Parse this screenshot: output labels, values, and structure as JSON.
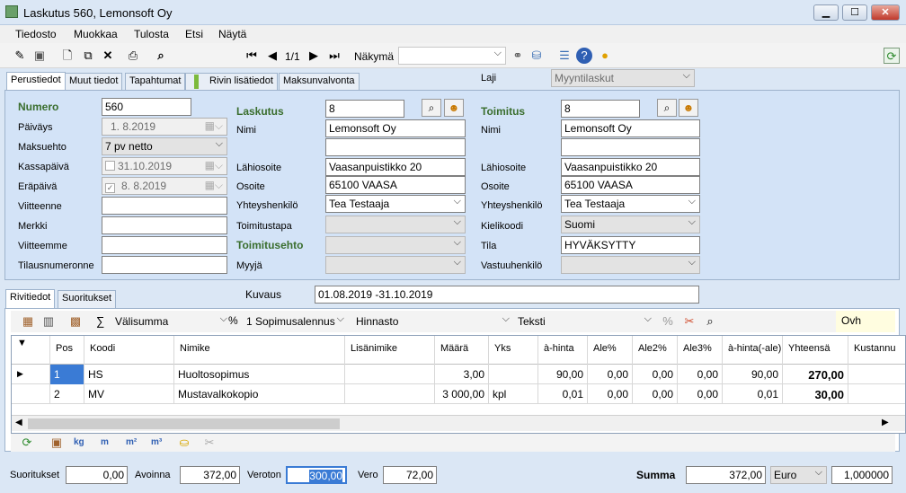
{
  "window": {
    "title": "Laskutus 560, Lemonsoft Oy",
    "min": "▁",
    "max": "☐",
    "close": "✕"
  },
  "menu": [
    "Tiedosto",
    "Muokkaa",
    "Tulosta",
    "Etsi",
    "Näytä"
  ],
  "toolbar": {
    "page": "1/1",
    "view_label": "Näkymä"
  },
  "tabs": [
    "Perustiedot",
    "Muut tiedot",
    "Tapahtumat",
    "Rivin lisätiedot",
    "Maksunvalvonta"
  ],
  "laji": {
    "label": "Laji",
    "value": "Myyntilaskut"
  },
  "left": {
    "numero_label": "Numero",
    "numero": "560",
    "paivays_label": "Päiväys",
    "paivays": "1. 8.2019",
    "maksuehto_label": "Maksuehto",
    "maksuehto": "7 pv netto",
    "kassapaiva_label": "Kassapäivä",
    "kassapaiva": "31.10.2019",
    "erapaiva_label": "Eräpäivä",
    "erapaiva": "8. 8.2019",
    "viitteenne_label": "Viitteenne",
    "viitteenne": "",
    "merkki_label": "Merkki",
    "merkki": "",
    "viitteemme_label": "Viitteemme",
    "viitteemme": "",
    "tilausnumeronne_label": "Tilausnumeronne",
    "tilausnumeronne": ""
  },
  "laskutus": {
    "label": "Laskutus",
    "number": "8",
    "nimi_label": "Nimi",
    "nimi": "Lemonsoft Oy",
    "nimi2": "",
    "lahiosoite_label": "Lähiosoite",
    "lahiosoite": "Vaasanpuistikko 20",
    "osoite_label": "Osoite",
    "osoite": "65100  VAASA",
    "yhteys_label": "Yhteyshenkilö",
    "yhteys": "Tea Testaaja",
    "toimitustapa_label": "Toimitustapa",
    "toimitustapa": "",
    "toimitusehto_label": "Toimitusehto",
    "toimitusehto": "",
    "myyja_label": "Myyjä",
    "myyja": ""
  },
  "toimitus": {
    "label": "Toimitus",
    "number": "8",
    "nimi_label": "Nimi",
    "nimi": "Lemonsoft Oy",
    "nimi2": "",
    "lahiosoite_label": "Lähiosoite",
    "lahiosoite": "Vaasanpuistikko 20",
    "osoite_label": "Osoite",
    "osoite": "65100  VAASA",
    "yhteys_label": "Yhteyshenkilö",
    "yhteys": "Tea Testaaja",
    "kielikoodi_label": "Kielikoodi",
    "kielikoodi": "Suomi",
    "tila_label": "Tila",
    "tila": "HYVÄKSYTTY",
    "vastuu_label": "Vastuuhenkilö",
    "vastuu": ""
  },
  "lower_tabs": [
    "Rivitiedot",
    "Suoritukset"
  ],
  "kuvaus": {
    "label": "Kuvaus",
    "value": "01.08.2019 -31.10.2019"
  },
  "row_toolbar": {
    "sigma": "∑",
    "valisumma": "Välisumma",
    "percent": "%",
    "sopimus": "1 Sopimusalennus",
    "hinnasto": "Hinnasto",
    "teksti": "Teksti",
    "ovh": "Ovh"
  },
  "grid": {
    "headers": [
      "Pos",
      "Koodi",
      "Nimike",
      "Lisänimike",
      "Määrä",
      "Yks",
      "à-hinta",
      "Ale%",
      "Ale2%",
      "Ale3%",
      "à-hinta(-ale)",
      "Yhteensä",
      "Kustannu"
    ],
    "rows": [
      [
        "1",
        "HS",
        "Huoltosopimus",
        "",
        "3,00",
        "",
        "90,00",
        "0,00",
        "0,00",
        "0,00",
        "90,00",
        "270,00",
        ""
      ],
      [
        "2",
        "MV",
        "Mustavalkokopio",
        "",
        "3 000,00",
        "kpl",
        "0,01",
        "0,00",
        "0,00",
        "0,00",
        "0,01",
        "30,00",
        ""
      ]
    ]
  },
  "bottom_toolbar": [
    "kg",
    "m",
    "m²",
    "m³"
  ],
  "totals": {
    "suoritukset_label": "Suoritukset",
    "suoritukset": "0,00",
    "avoinna_label": "Avoinna",
    "avoinna": "372,00",
    "veroton_label": "Veroton",
    "veroton": "300,00",
    "vero_label": "Vero",
    "vero": "72,00",
    "summa_label": "Summa",
    "summa": "372,00",
    "currency": "Euro",
    "rate": "1,000000"
  }
}
